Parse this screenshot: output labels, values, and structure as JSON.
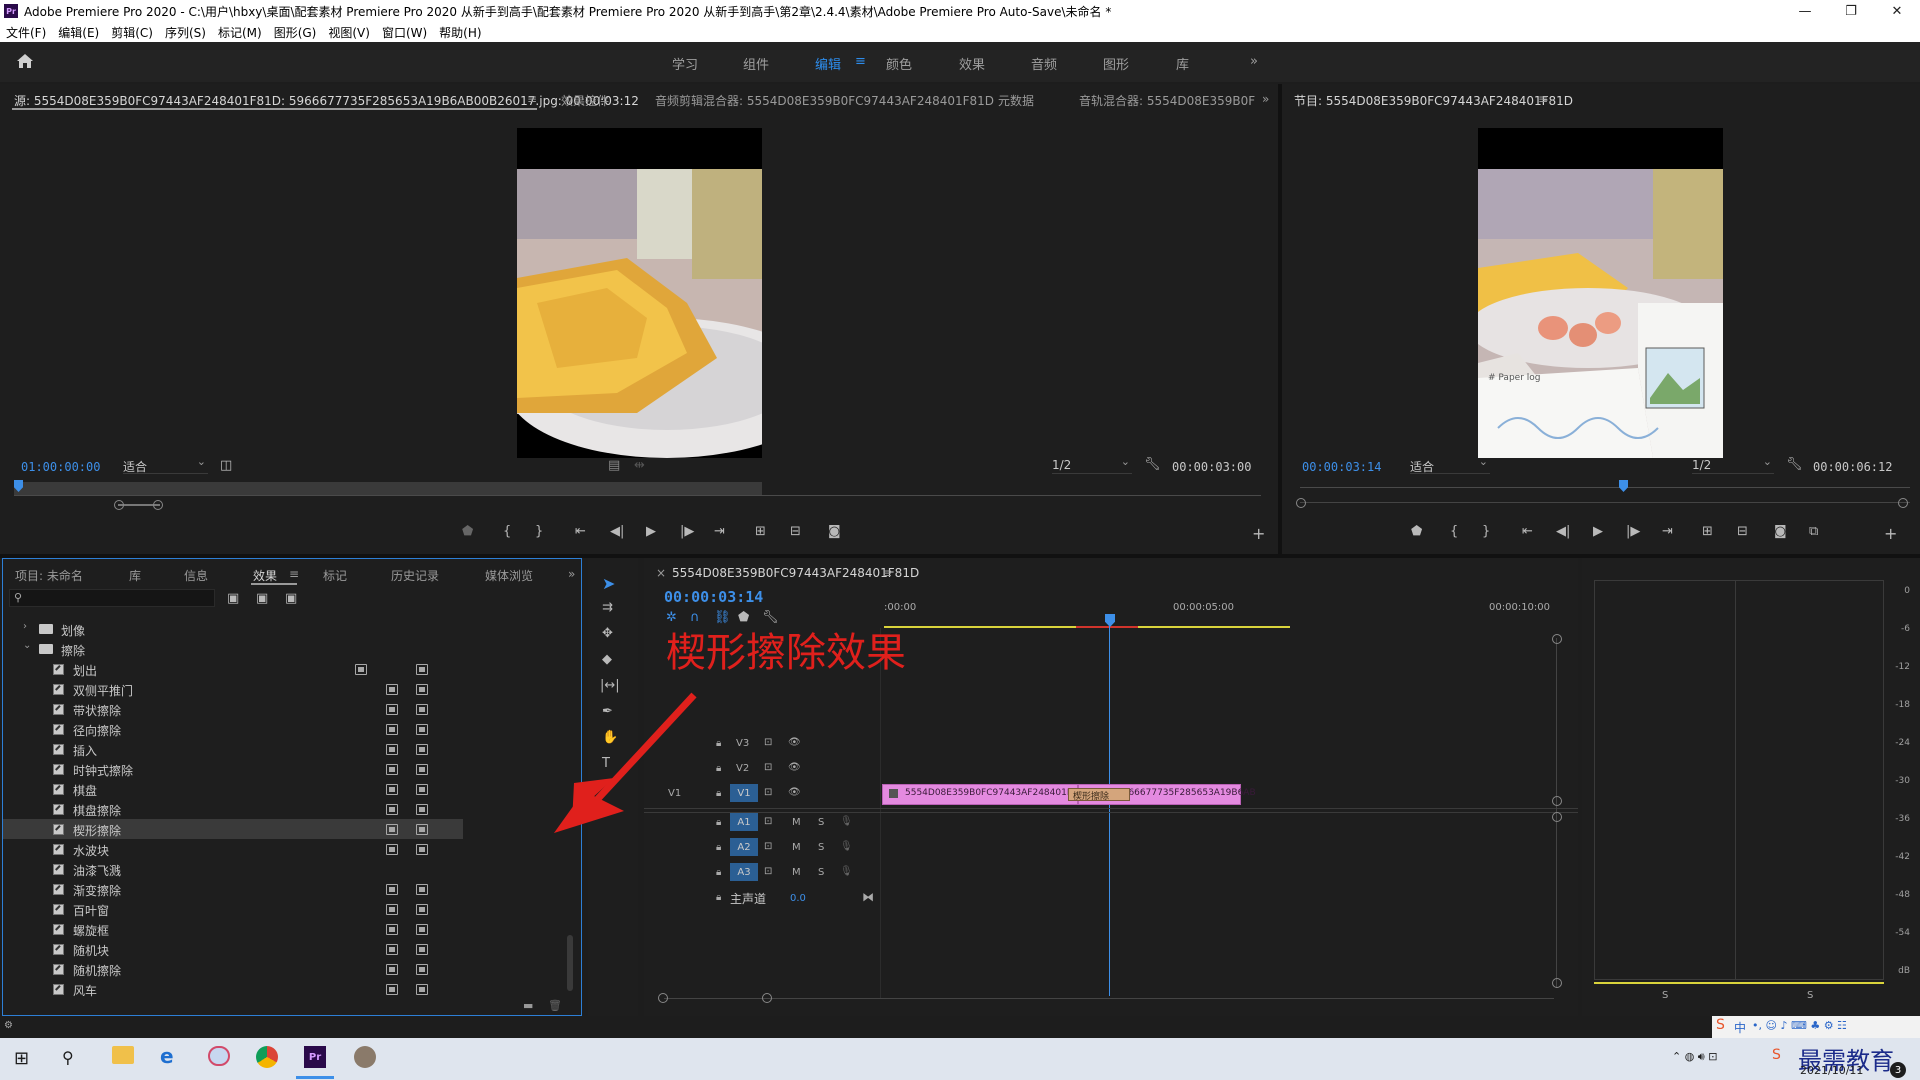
{
  "window": {
    "title": "Adobe Premiere Pro 2020 - C:\\用户\\hbxy\\桌面\\配套素材 Premiere Pro 2020 从新手到高手\\配套素材 Premiere Pro 2020 从新手到高手\\第2章\\2.4.4\\素材\\Adobe Premiere Pro Auto-Save\\未命名 *",
    "app_icon": "Pr",
    "controls": [
      "—",
      "❐",
      "✕"
    ]
  },
  "menu": [
    "文件(F)",
    "编辑(E)",
    "剪辑(C)",
    "序列(S)",
    "标记(M)",
    "图形(G)",
    "视图(V)",
    "窗口(W)",
    "帮助(H)"
  ],
  "workspaces": {
    "tabs": [
      "学习",
      "组件",
      "编辑",
      "颜色",
      "效果",
      "音频",
      "图形",
      "库"
    ],
    "active": "编辑",
    "menu_glyph": "≡",
    "more": "»"
  },
  "source_panel": {
    "tabs": [
      "源: 5554D08E359B0FC97443AF248401F81D: 5966677735F285653A19B6AB00B26017.jpg: 00:00:03:12",
      "效果控件",
      "音频剪辑混合器: 5554D08E359B0FC97443AF248401F81D",
      "元数据",
      "音轨混合器: 5554D08E359B0F"
    ],
    "menu_glyph": "≡",
    "more": "»",
    "timecode_in": "01:00:00:00",
    "fit": "适合",
    "resolution": "1/2",
    "duration": "00:00:03:00",
    "playhead_fraction": 0.0
  },
  "program_panel": {
    "title": "节目: 5554D08E359B0FC97443AF248401F81D",
    "menu_glyph": "≡",
    "timecode": "00:00:03:14",
    "fit": "适合",
    "resolution": "1/2",
    "duration": "00:00:06:12",
    "playhead_fraction": 0.55,
    "image_text": "# Paper log"
  },
  "project_panel": {
    "tabs": [
      "项目: 未命名",
      "库",
      "信息",
      "效果",
      "标记",
      "历史记录",
      "媒体浏览"
    ],
    "active_tab": "效果",
    "menu_glyph": "≡",
    "more": "»",
    "search_placeholder": "",
    "folders": [
      {
        "name": "划像",
        "expanded": false
      },
      {
        "name": "擦除",
        "expanded": true
      }
    ],
    "items": [
      {
        "label": "划出",
        "b1": true,
        "b2": true
      },
      {
        "label": "双侧平推门",
        "b1": true,
        "b2": true
      },
      {
        "label": "带状擦除",
        "b1": true,
        "b2": true
      },
      {
        "label": "径向擦除",
        "b1": true,
        "b2": true
      },
      {
        "label": "插入",
        "b1": true,
        "b2": true
      },
      {
        "label": "时钟式擦除",
        "b1": true,
        "b2": true
      },
      {
        "label": "棋盘",
        "b1": true,
        "b2": true
      },
      {
        "label": "棋盘擦除",
        "b1": true,
        "b2": true
      },
      {
        "label": "楔形擦除",
        "b1": true,
        "b2": true,
        "selected": true
      },
      {
        "label": "水波块",
        "b1": true,
        "b2": true
      },
      {
        "label": "油漆飞溅",
        "b1": false,
        "b2": false
      },
      {
        "label": "渐变擦除",
        "b1": true,
        "b2": true
      },
      {
        "label": "百叶窗",
        "b1": true,
        "b2": true
      },
      {
        "label": "螺旋框",
        "b1": true,
        "b2": true
      },
      {
        "label": "随机块",
        "b1": true,
        "b2": true
      },
      {
        "label": "随机擦除",
        "b1": true,
        "b2": true
      },
      {
        "label": "风车",
        "b1": true,
        "b2": true
      }
    ]
  },
  "timeline": {
    "sequence_name": "5554D08E359B0FC97443AF248401F81D",
    "menu_glyph": "≡",
    "close": "×",
    "timecode": "00:00:03:14",
    "ruler": [
      ":00:00",
      "00:00:05:00",
      "00:00:10:00"
    ],
    "annotation": "楔形擦除效果",
    "video_tracks": [
      "V3",
      "V2",
      "V1"
    ],
    "audio_tracks": [
      "A1",
      "A2",
      "A3"
    ],
    "source_patch": "V1",
    "master": {
      "label": "主声道",
      "value": "0.0"
    },
    "track_buttons": {
      "mute": "M",
      "solo": "S"
    },
    "clips": [
      {
        "name": "5554D08E359B0FC97443AF248401F81",
        "track": "V1"
      },
      {
        "name": "5966677735F285653A19B6AB",
        "track": "V1"
      }
    ],
    "transition": "楔形擦除"
  },
  "audio_meter": {
    "scale": [
      "0",
      "-6",
      "-12",
      "-18",
      "-24",
      "-30",
      "-36",
      "-42",
      "-48",
      "-54",
      "dB"
    ],
    "solo_labels": [
      "S",
      "S"
    ]
  },
  "taskbar": {
    "ime": "中",
    "date": "2021/10/11",
    "watermark": "最需教育",
    "notifications": "3"
  },
  "colors": {
    "accent_blue": "#2d8ceb",
    "clip_pink": "#e48ae0",
    "annotation_red": "#e0201c",
    "panel_bg": "#1e1e1e"
  }
}
